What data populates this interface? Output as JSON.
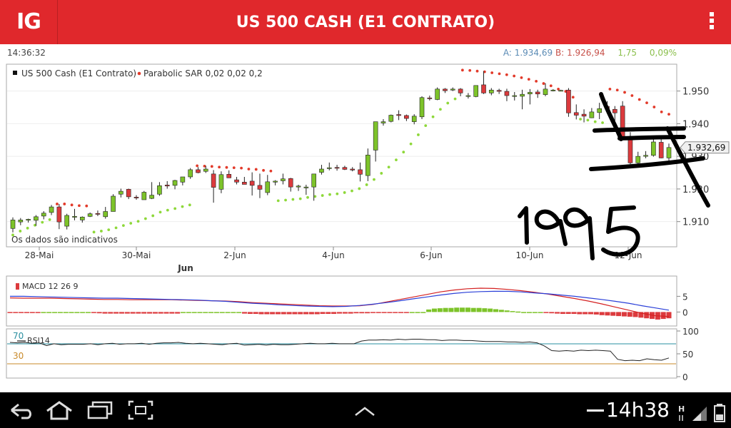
{
  "header": {
    "logo": "IG",
    "title": "US 500 CASH (E1 CONTRATO)"
  },
  "quote": {
    "time": "14:36:32",
    "ask_label": "A:",
    "ask": "1.934,69",
    "bid_label": "B:",
    "bid": "1.926,94",
    "change": "1,75",
    "change_pct": "0,09%"
  },
  "colors": {
    "brand": "#e0282c",
    "up_candle": "#7dc32a",
    "down_candle": "#dc3a3d",
    "sar_up": "#8ed83a",
    "sar_down": "#e23a2a",
    "macd_line": "#d42020",
    "signal_line": "#2a3fd8",
    "rsi_line": "#222222",
    "rsi_70": "#2a8fa0",
    "rsi_30": "#c98a2a"
  },
  "chart_data": [
    {
      "type": "candlestick",
      "title": "US 500 Cash (E1 Contrato)",
      "indicator": "Parabolic SAR 0,02 0,02 0,2",
      "note": "Os dados são indicativos",
      "current_price_label": "1.932,69",
      "ylim": [
        1902.5,
        1958
      ],
      "y_ticks": [
        "1.950",
        "1.940",
        "1.930",
        "1.920",
        "1.910"
      ],
      "x_ticks": [
        "28-Mai",
        "30-Mai",
        "2-Jun",
        "4-Jun",
        "6-Jun",
        "10-Jun",
        "12-Jun"
      ],
      "x_month_label": "Jun",
      "ohlc": [
        [
          1907.9,
          1911.3,
          1906.7,
          1910.5
        ],
        [
          1909.9,
          1911.1,
          1908.9,
          1910.5
        ],
        [
          1910.7,
          1910.9,
          1909.7,
          1910.7
        ],
        [
          1910.4,
          1912.0,
          1908.7,
          1911.5
        ],
        [
          1911.7,
          1913.2,
          1910.7,
          1912.6
        ],
        [
          1912.8,
          1915.1,
          1912.0,
          1914.5
        ],
        [
          1914.5,
          1915.4,
          1907.7,
          1909.9
        ],
        [
          1908.6,
          1912.4,
          1907.6,
          1911.9
        ],
        [
          1911.5,
          1913.9,
          1910.4,
          1911.6
        ],
        [
          1910.5,
          1911.6,
          1909.7,
          1911.4
        ],
        [
          1911.6,
          1912.8,
          1911.4,
          1912.4
        ],
        [
          1912.5,
          1913.4,
          1911.7,
          1912.4
        ],
        [
          1911.5,
          1914.5,
          1910.9,
          1913.1
        ],
        [
          1913.1,
          1918.4,
          1913.1,
          1917.8
        ],
        [
          1918.4,
          1920.1,
          1917.4,
          1919.3
        ],
        [
          1919.9,
          1920.1,
          1916.9,
          1917.6
        ],
        [
          1917.5,
          1918.1,
          1916.7,
          1917.3
        ],
        [
          1916.7,
          1919.4,
          1916.7,
          1919.0
        ],
        [
          1917.1,
          1922.1,
          1916.9,
          1918.1
        ],
        [
          1918.4,
          1922.1,
          1917.9,
          1921.0
        ],
        [
          1921.2,
          1922.4,
          1920.1,
          1920.9
        ],
        [
          1921.1,
          1922.8,
          1919.9,
          1922.6
        ],
        [
          1922.1,
          1923.4,
          1921.1,
          1923.7
        ],
        [
          1923.7,
          1926.4,
          1923.1,
          1925.9
        ],
        [
          1925.9,
          1926.7,
          1924.8,
          1925.0
        ],
        [
          1925.4,
          1927.1,
          1924.9,
          1926.1
        ],
        [
          1924.6,
          1925.8,
          1915.8,
          1920.5
        ],
        [
          1919.9,
          1925.4,
          1918.7,
          1924.4
        ],
        [
          1924.5,
          1925.7,
          1923.4,
          1923.4
        ],
        [
          1922.8,
          1923.7,
          1921.4,
          1922.1
        ],
        [
          1922.1,
          1923.7,
          1921.6,
          1921.4
        ],
        [
          1922.4,
          1925.1,
          1918.0,
          1921.1
        ],
        [
          1921.1,
          1924.7,
          1917.2,
          1919.9
        ],
        [
          1918.9,
          1924.3,
          1918.1,
          1922.2
        ],
        [
          1922.1,
          1922.7,
          1921.1,
          1922.4
        ],
        [
          1922.5,
          1924.7,
          1921.4,
          1923.1
        ],
        [
          1923.2,
          1923.4,
          1919.2,
          1920.6
        ],
        [
          1920.6,
          1921.3,
          1919.4,
          1920.9
        ],
        [
          1920.5,
          1921.3,
          1918.2,
          1920.6
        ],
        [
          1920.6,
          1924.6,
          1916.4,
          1924.6
        ],
        [
          1925.1,
          1927.4,
          1924.4,
          1926.1
        ],
        [
          1926.5,
          1928.1,
          1925.7,
          1926.5
        ],
        [
          1926.6,
          1927.4,
          1925.6,
          1926.4
        ],
        [
          1926.6,
          1927.1,
          1925.8,
          1926.0
        ],
        [
          1926.1,
          1926.7,
          1925.4,
          1925.8
        ],
        [
          1925.9,
          1928.1,
          1922.3,
          1924.5
        ],
        [
          1924.1,
          1932.4,
          1922.4,
          1930.4
        ],
        [
          1931.9,
          1939.1,
          1928.4,
          1940.6
        ],
        [
          1940.2,
          1941.4,
          1939.4,
          1940.6
        ],
        [
          1940.7,
          1942.8,
          1940.4,
          1942.6
        ],
        [
          1942.8,
          1944.1,
          1941.1,
          1942.5
        ],
        [
          1942.5,
          1942.8,
          1940.8,
          1941.6
        ],
        [
          1940.6,
          1942.9,
          1939.8,
          1942.3
        ],
        [
          1942.1,
          1948.4,
          1941.4,
          1948.0
        ],
        [
          1947.9,
          1948.6,
          1947.1,
          1947.8
        ],
        [
          1947.4,
          1951.1,
          1947.2,
          1950.6
        ],
        [
          1950.6,
          1950.9,
          1949.4,
          1950.1
        ],
        [
          1950.3,
          1951.1,
          1950.0,
          1950.6
        ],
        [
          1950.6,
          1950.9,
          1948.4,
          1949.4
        ],
        [
          1948.4,
          1949.4,
          1947.7,
          1948.6
        ],
        [
          1948.3,
          1951.4,
          1948.1,
          1951.7
        ],
        [
          1951.9,
          1956.1,
          1949.1,
          1949.4
        ],
        [
          1949.4,
          1950.9,
          1948.7,
          1950.3
        ],
        [
          1950.2,
          1950.7,
          1949.1,
          1949.9
        ],
        [
          1949.9,
          1950.7,
          1946.9,
          1948.6
        ],
        [
          1948.4,
          1949.7,
          1947.1,
          1948.6
        ],
        [
          1948.4,
          1950.4,
          1944.4,
          1949.0
        ],
        [
          1949.1,
          1950.6,
          1945.9,
          1949.6
        ],
        [
          1949.7,
          1950.4,
          1947.9,
          1949.1
        ],
        [
          1948.9,
          1952.4,
          1948.4,
          1950.6
        ],
        [
          1950.1,
          1950.6,
          1949.9,
          1950.3
        ],
        [
          1950.2,
          1950.4,
          1949.9,
          1950.2
        ],
        [
          1950.3,
          1950.9,
          1942.1,
          1943.3
        ],
        [
          1943.4,
          1945.9,
          1941.3,
          1942.6
        ],
        [
          1942.9,
          1944.4,
          1940.4,
          1942.3
        ],
        [
          1941.8,
          1944.8,
          1941.7,
          1943.6
        ],
        [
          1943.4,
          1946.4,
          1941.4,
          1944.6
        ],
        [
          1945.3,
          1946.9,
          1943.9,
          1944.5
        ],
        [
          1944.4,
          1945.4,
          1940.9,
          1943.3
        ],
        [
          1945.4,
          1946.9,
          1934.9,
          1935.9
        ],
        [
          1936.1,
          1937.4,
          1927.6,
          1928.0
        ],
        [
          1928.0,
          1931.4,
          1927.7,
          1930.0
        ],
        [
          1930.0,
          1931.6,
          1929.4,
          1930.3
        ],
        [
          1930.3,
          1935.4,
          1929.9,
          1934.4
        ],
        [
          1934.3,
          1935.6,
          1929.4,
          1929.5
        ],
        [
          1929.5,
          1933.9,
          1927.6,
          1932.7
        ]
      ],
      "parabolic_sar": [
        1905.9,
        1907.1,
        1908.0,
        1908.9,
        1909.8,
        1910.6,
        1915.4,
        1915.4,
        1915.1,
        1914.9,
        1914.8,
        1906.8,
        1907.1,
        1907.5,
        1908.1,
        1908.8,
        1909.5,
        1910.1,
        1910.9,
        1911.8,
        1912.9,
        1913.5,
        1914.0,
        1914.6,
        1915.1,
        1927.1,
        1927.0,
        1926.9,
        1926.7,
        1926.6,
        1926.5,
        1926.4,
        1926.1,
        1926.0,
        1925.7,
        1925.5,
        1916.4,
        1916.6,
        1916.8,
        1917.0,
        1917.4,
        1917.7,
        1918.0,
        1918.3,
        1918.5,
        1918.9,
        1919.4,
        1920.1,
        1921.3,
        1922.9,
        1924.8,
        1926.7,
        1928.9,
        1931.3,
        1933.8,
        1936.6,
        1939.4,
        1942.1,
        1944.4,
        1946.3,
        1947.6,
        1956.4,
        1956.3,
        1956.1,
        1955.9,
        1955.6,
        1955.3,
        1955.0,
        1954.6,
        1954.1,
        1953.6,
        1953.0,
        1952.3,
        1951.6,
        1950.6,
        1949.9,
        1948.1,
        1941.4,
        1941.1,
        1940.6,
        1940.3,
        1950.6,
        1950.3,
        1949.6,
        1948.6,
        1947.4,
        1946.4,
        1945.1,
        1943.6,
        1942.9
      ]
    },
    {
      "type": "bar+line",
      "title": "MACD 12 26 9",
      "y_ticks": [
        "5",
        "0"
      ],
      "ylim": [
        -4,
        11
      ],
      "histogram": [
        -0.25,
        -0.25,
        -0.25,
        -0.25,
        -0.25,
        -0.25,
        0,
        0,
        0,
        0,
        0,
        0,
        0,
        0,
        0,
        -0.3,
        -0.4,
        -0.5,
        -0.5,
        -0.5,
        -0.5,
        -0.5,
        -0.5,
        -0.5,
        -0.5,
        -0.5,
        -0.5,
        -0.5,
        -0.5,
        -0.5,
        -0.5,
        0,
        0,
        0,
        0,
        0,
        0,
        0,
        0,
        0,
        0,
        0,
        -0.5,
        -0.6,
        -0.6,
        -0.7,
        -0.7,
        -0.7,
        -0.7,
        -0.7,
        -0.7,
        -0.7,
        -0.7,
        -0.7,
        -0.7,
        -0.7,
        -0.6,
        -0.6,
        -0.6,
        -0.5,
        -0.5,
        -0.5,
        -0.4,
        -0.4,
        -0.4,
        -0.3,
        -0.3,
        -0.3,
        -0.2,
        -0.2,
        -0.2,
        -0.2,
        0,
        0,
        0,
        0.8,
        1.1,
        1.2,
        1.3,
        1.3,
        1.4,
        1.4,
        1.4,
        1.3,
        1.3,
        1.2,
        1.1,
        0.9,
        0.7,
        0.5,
        0.3,
        0.15,
        0,
        0,
        0,
        0,
        -0.3,
        -0.4,
        -0.5,
        -0.6,
        -0.6,
        -0.6,
        -0.7,
        -0.7,
        -0.7,
        -0.8,
        -1.0,
        -1.1,
        -1.2,
        -1.3,
        -1.4,
        -1.5,
        -1.6,
        -1.8,
        -2.0,
        -2.2,
        -2.4,
        -2.2,
        -2.0
      ],
      "macd": [
        4.5,
        4.4,
        4.4,
        4.4,
        4.3,
        4.2,
        4.1,
        4.0,
        4.0,
        3.9,
        3.9,
        3.9,
        3.9,
        3.8,
        3.7,
        3.6,
        3.5,
        3.3,
        3.0,
        2.8,
        2.6,
        2.4,
        2.2,
        2.0,
        1.9,
        1.9,
        2.0,
        2.4,
        3.2,
        4.0,
        4.8,
        5.6,
        6.4,
        7.0,
        7.4,
        7.6,
        7.5,
        7.2,
        6.8,
        6.3,
        5.7,
        5.0,
        4.3,
        3.5,
        2.6,
        1.6,
        0.6,
        -0.4,
        -1.2,
        -1.4
      ],
      "signal": [
        5.0,
        5.0,
        4.9,
        4.8,
        4.7,
        4.6,
        4.5,
        4.4,
        4.4,
        4.3,
        4.2,
        4.1,
        4.0,
        3.9,
        3.8,
        3.6,
        3.4,
        3.1,
        2.8,
        2.6,
        2.3,
        2.1,
        1.9,
        1.8,
        1.7,
        1.8,
        2.1,
        2.5,
        3.0,
        3.6,
        4.2,
        4.8,
        5.4,
        5.9,
        6.3,
        6.5,
        6.6,
        6.6,
        6.4,
        6.1,
        5.8,
        5.4,
        5.0,
        4.5,
        4.0,
        3.4,
        2.8,
        2.0,
        1.3,
        0.6
      ]
    },
    {
      "type": "line",
      "title": "RSI14",
      "y_ticks": [
        "100",
        "50",
        "0"
      ],
      "levels": [
        "70",
        "30"
      ],
      "ylim": [
        0,
        100
      ],
      "values": [
        75,
        74,
        75,
        73,
        74,
        68,
        72,
        70,
        71,
        71,
        71,
        72,
        70,
        72,
        73,
        71,
        72,
        72,
        73,
        71,
        73,
        74,
        74,
        75,
        73,
        72,
        73,
        72,
        71,
        70,
        72,
        73,
        69,
        70,
        71,
        69,
        71,
        70,
        70,
        71,
        72,
        73,
        72,
        72,
        73,
        72,
        72,
        72,
        78,
        80,
        80,
        81,
        80,
        82,
        81,
        82,
        82,
        81,
        81,
        79,
        80,
        80,
        79,
        79,
        78,
        77,
        77,
        77,
        76,
        76,
        75,
        76,
        74,
        67,
        57,
        56,
        57,
        56,
        58,
        57,
        58,
        57,
        56,
        38,
        35,
        36,
        35,
        39,
        37,
        36,
        41
      ]
    }
  ],
  "navbar": {
    "clock": "14h38",
    "icons": [
      "back-icon",
      "home-icon",
      "recent-apps-icon",
      "screenshot-icon",
      "up-chevron-icon",
      "signal-icon",
      "battery-icon"
    ]
  }
}
